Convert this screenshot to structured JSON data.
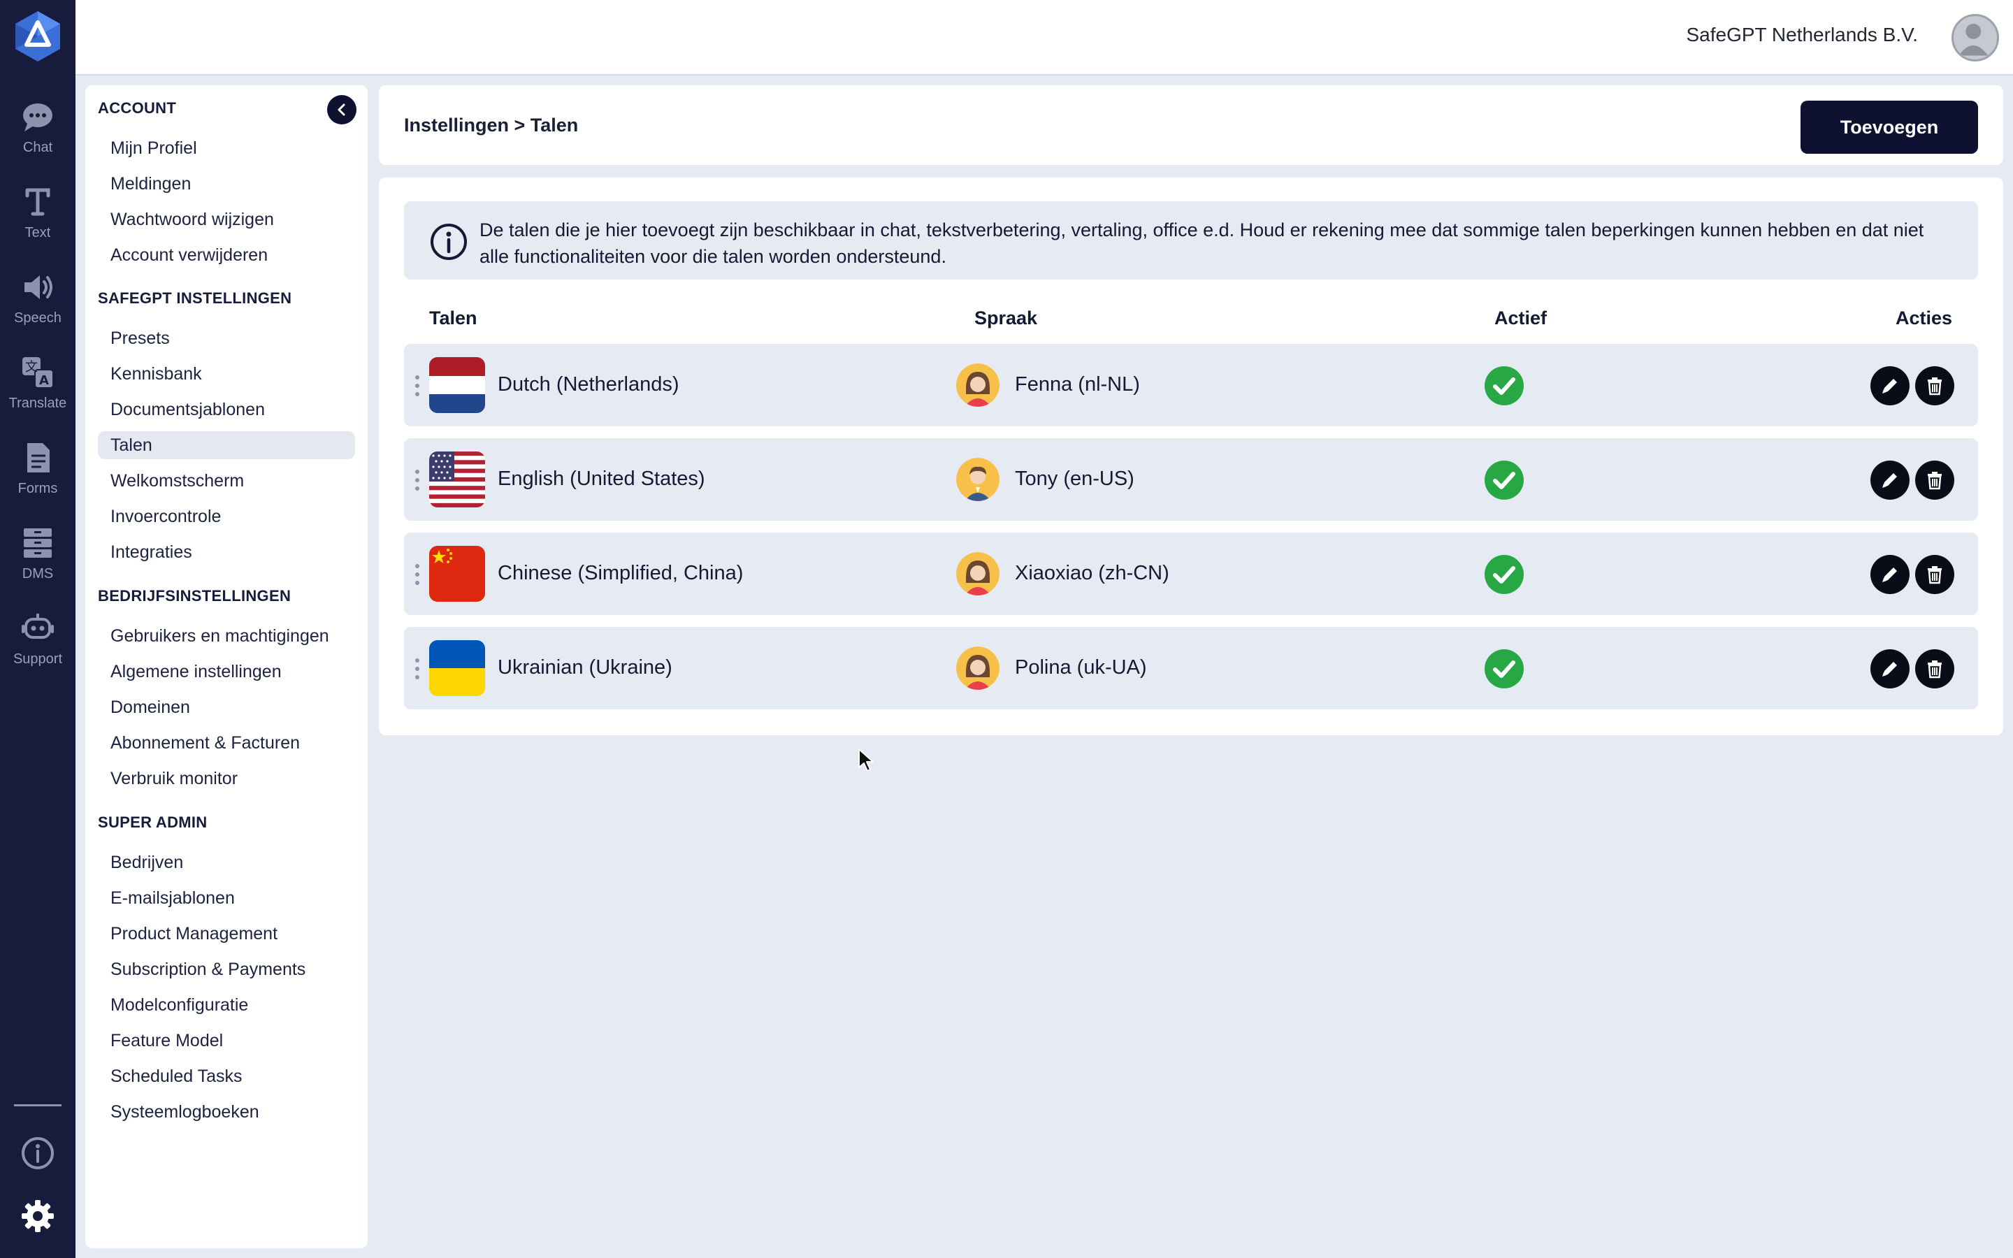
{
  "rail": {
    "items": [
      {
        "label": "Chat",
        "icon": "chat-bubble-icon"
      },
      {
        "label": "Text",
        "icon": "text-icon"
      },
      {
        "label": "Speech",
        "icon": "speaker-icon"
      },
      {
        "label": "Translate",
        "icon": "translate-icon"
      },
      {
        "label": "Forms",
        "icon": "forms-icon"
      },
      {
        "label": "DMS",
        "icon": "archive-icon"
      },
      {
        "label": "Support",
        "icon": "support-robot-icon"
      }
    ],
    "bottom": [
      {
        "icon": "info-icon"
      },
      {
        "icon": "gear-icon"
      }
    ]
  },
  "topbar": {
    "company": "SafeGPT Netherlands B.V."
  },
  "sidebar": {
    "sections": [
      {
        "title": "ACCOUNT",
        "items": [
          "Mijn Profiel",
          "Meldingen",
          "Wachtwoord wijzigen",
          "Account verwijderen"
        ]
      },
      {
        "title": "SAFEGPT INSTELLINGEN",
        "items": [
          "Presets",
          "Kennisbank",
          "Documentsjablonen",
          "Talen",
          "Welkomstscherm",
          "Invoercontrole",
          "Integraties"
        ]
      },
      {
        "title": "BEDRIJFSINSTELLINGEN",
        "items": [
          "Gebruikers en machtigingen",
          "Algemene instellingen",
          "Domeinen",
          "Abonnement & Facturen",
          "Verbruik monitor"
        ]
      },
      {
        "title": "SUPER ADMIN",
        "items": [
          "Bedrijven",
          "E-mailsjablonen",
          "Product Management",
          "Subscription & Payments",
          "Modelconfiguratie",
          "Feature Model",
          "Scheduled Tasks",
          "Systeemlogboeken"
        ]
      }
    ],
    "active_item": "Talen"
  },
  "header": {
    "breadcrumb": "Instellingen > Talen",
    "add_button": "Toevoegen"
  },
  "info": {
    "text": "De talen die je hier toevoegt zijn beschikbaar in chat, tekstverbetering, vertaling, office e.d. Houd er rekening mee dat sommige talen beperkingen kunnen hebben en dat niet alle functionaliteiten voor die talen worden ondersteund."
  },
  "table": {
    "headers": {
      "language": "Talen",
      "voice": "Spraak",
      "active": "Actief",
      "actions": "Acties"
    },
    "rows": [
      {
        "language": "Dutch (Netherlands)",
        "flag": "nl",
        "voice": "Fenna (nl-NL)",
        "voice_avatar": "female-avatar",
        "active": true
      },
      {
        "language": "English (United States)",
        "flag": "us",
        "voice": "Tony (en-US)",
        "voice_avatar": "male-avatar",
        "active": true
      },
      {
        "language": "Chinese (Simplified, China)",
        "flag": "cn",
        "voice": "Xiaoxiao (zh-CN)",
        "voice_avatar": "female-avatar",
        "active": true
      },
      {
        "language": "Ukrainian (Ukraine)",
        "flag": "ua",
        "voice": "Polina (uk-UA)",
        "voice_avatar": "female-avatar",
        "active": true
      }
    ]
  },
  "colors": {
    "rail_bg": "#171c3c",
    "primary_button": "#0e1130",
    "page_bg": "#e6ebf3",
    "check_green": "#27a844"
  }
}
